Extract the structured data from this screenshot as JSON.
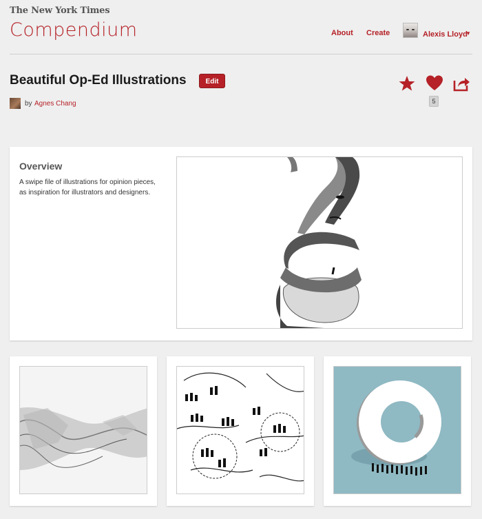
{
  "header": {
    "publisher": "The New York Times",
    "app_title": "Compendium",
    "nav": {
      "about": "About",
      "create": "Create"
    },
    "user": {
      "name": "Alexis Lloyd",
      "caret": "▼"
    }
  },
  "collection": {
    "title": "Beautiful Op-Ed Illustrations",
    "edit_label": "Edit",
    "by_label": "by",
    "author": "Agnes Chang",
    "like_count": "5"
  },
  "overview": {
    "heading": "Overview",
    "description": "A swipe file of illustrations for opinion pieces, as inspiration for illustrators and designers."
  },
  "colors": {
    "accent": "#b52127",
    "background": "#efefef",
    "card": "#ffffff",
    "teal_thumb": "#8fb9c3"
  },
  "icons": [
    "star-icon",
    "heart-icon",
    "share-icon",
    "chevron-down-icon"
  ]
}
